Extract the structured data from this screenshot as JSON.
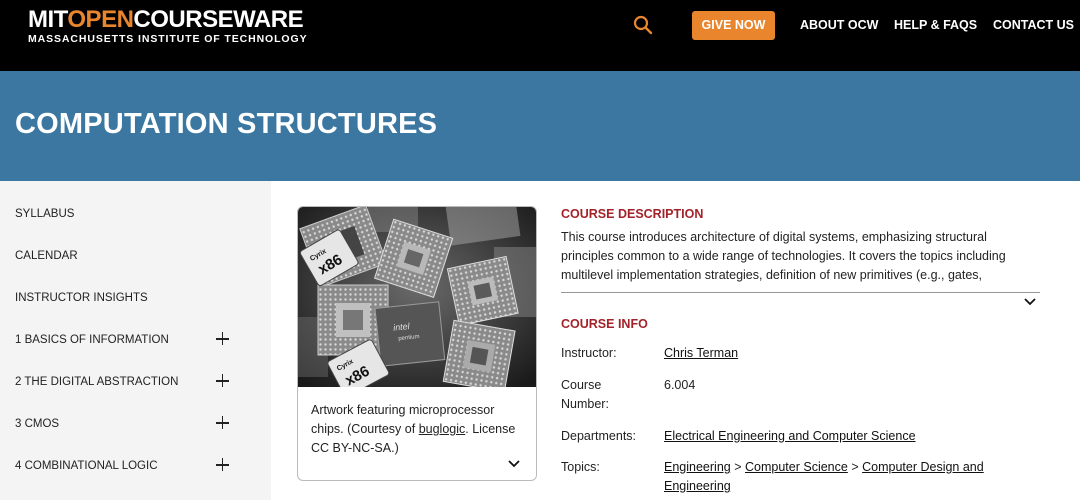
{
  "header": {
    "logo_part1": "MIT",
    "logo_part2": "OPEN",
    "logo_part3": "COURSEWARE",
    "logo_sub": "MASSACHUSETTS INSTITUTE OF TECHNOLOGY",
    "search_icon": "search-icon",
    "give_label": "GIVE NOW",
    "nav": [
      "ABOUT OCW",
      "HELP & FAQS",
      "CONTACT US"
    ]
  },
  "banner": {
    "title": "COMPUTATION STRUCTURES"
  },
  "sidebar": {
    "items": [
      {
        "label": "SYLLABUS",
        "expandable": false
      },
      {
        "label": "CALENDAR",
        "expandable": false
      },
      {
        "label": "INSTRUCTOR INSIGHTS",
        "expandable": false
      },
      {
        "label": "1 BASICS OF INFORMATION",
        "expandable": true
      },
      {
        "label": "2 THE DIGITAL ABSTRACTION",
        "expandable": true
      },
      {
        "label": "3 CMOS",
        "expandable": true
      },
      {
        "label": "4 COMBINATIONAL LOGIC",
        "expandable": true
      }
    ]
  },
  "image_card": {
    "caption_before": "Artwork featuring microprocessor chips. (Courtesy of ",
    "caption_link": "buglogic",
    "caption_after": ". License CC BY-NC-SA.)",
    "chip_label_1": "Cyrix",
    "chip_label_2": "x86",
    "chip_label_3": "intel",
    "chip_label_4": "pentium"
  },
  "description": {
    "heading": "COURSE DESCRIPTION",
    "text": "This course introduces architecture of digital systems, emphasizing structural principles common to a wide range of technologies. It covers the topics including multilevel implementation strategies, definition of new primitives (e.g., gates,"
  },
  "course_info": {
    "heading": "COURSE INFO",
    "instructor_label": "Instructor:",
    "instructor": "Chris Terman",
    "number_label_1": "Course",
    "number_label_2": "Number:",
    "number": "6.004",
    "departments_label": "Departments:",
    "department": "Electrical Engineering and Computer Science",
    "topics_label": "Topics:",
    "topics": [
      "Engineering",
      "Computer Science",
      "Computer Design and",
      "Engineering"
    ],
    "topic_separator": ">"
  },
  "colors": {
    "accent": "#e9852d",
    "banner": "#3b77a0",
    "heading": "#a3222a",
    "sidebar": "#f4f4f4"
  }
}
